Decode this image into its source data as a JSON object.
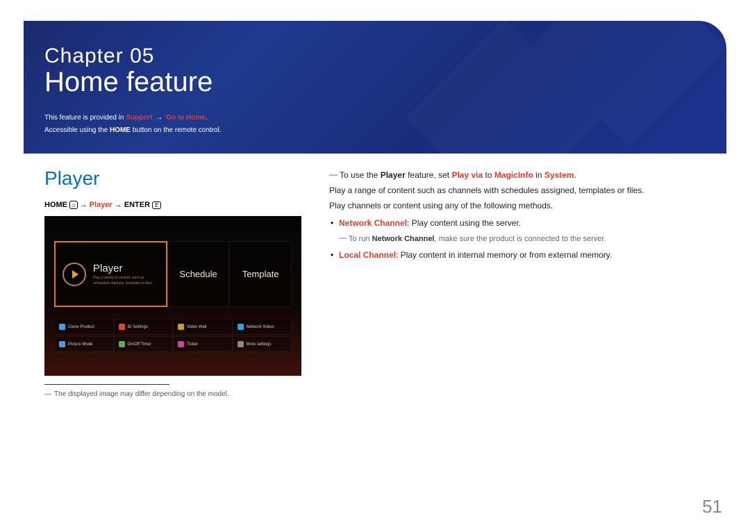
{
  "hero": {
    "chapter_word": "Chapter",
    "chapter_num": "05",
    "title": "Home feature",
    "sub_line1_pre": "This feature is provided in ",
    "sub_line1_red1": "Support",
    "sub_line1_arrow": " → ",
    "sub_line1_red2": "Go to Home",
    "sub_line1_post": ".",
    "sub_line2_pre": "Accessible using the ",
    "sub_line2_bold": "HOME",
    "sub_line2_post": " button on the remote control."
  },
  "section": {
    "title": "Player",
    "nav_home": "HOME",
    "nav_icon1": "⌂",
    "nav_arrow": " → ",
    "nav_player": "Player",
    "nav_enter": "ENTER",
    "nav_icon2": "⏎"
  },
  "screenshot": {
    "tile_player": "Player",
    "tile_player_sub1": "Play a variety of content, such as",
    "tile_player_sub2": "scheduled channels, templates or files.",
    "tile_schedule": "Schedule",
    "tile_template": "Template",
    "cells_r1": [
      "Clone Product",
      "ID Settings",
      "Video Wall",
      "Network Status"
    ],
    "cells_r2": [
      "Picture Mode",
      "On/Off Timer",
      "Ticker",
      "More settings"
    ],
    "icon_colors_r1": [
      "#3aa0e8",
      "#d94a3a",
      "#c0a030",
      "#3a9ad4"
    ],
    "icon_colors_r2": [
      "#3aa0e8",
      "#4aba4a",
      "#c44aa0",
      "#888888"
    ]
  },
  "footnote": {
    "text": "The displayed image may differ depending on the model."
  },
  "right": {
    "note1_pre": "To use the ",
    "note1_b1": "Player",
    "note1_mid1": " feature, set ",
    "note1_r1": "Play via",
    "note1_mid2": " to ",
    "note1_r2": "MagicInfo",
    "note1_mid3": " in ",
    "note1_r3": "System",
    "note1_post": ".",
    "p1": "Play a range of content such as channels with schedules assigned, templates or files.",
    "p2": "Play channels or content using any of the following methods.",
    "li1_label": "Network Channel",
    "li1_text": ": Play content using the server.",
    "li1_note_pre": "To run ",
    "li1_note_b": "Network Channel",
    "li1_note_post": ", make sure the product is connected to the server.",
    "li2_label": "Local Channel",
    "li2_text": ": Play content in internal memory or from external memory."
  },
  "page_number": "51"
}
